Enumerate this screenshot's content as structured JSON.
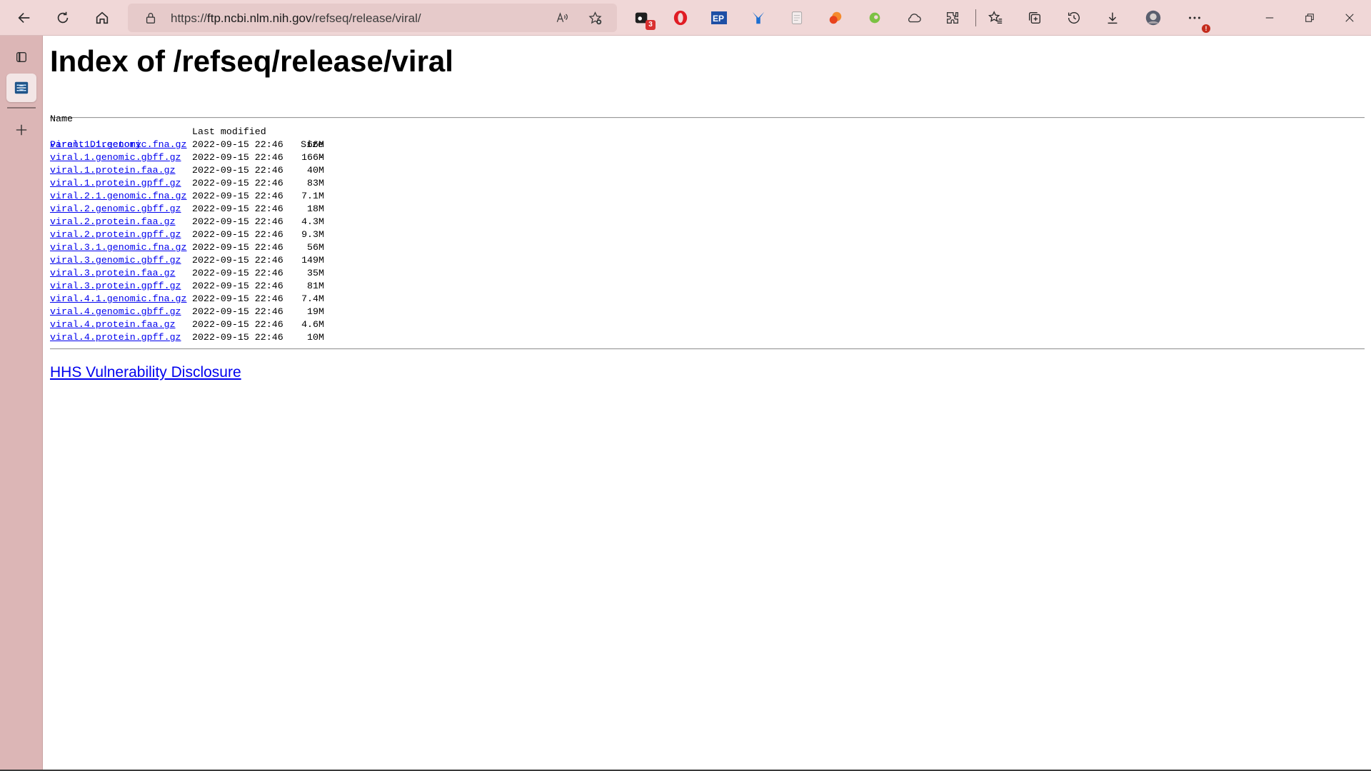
{
  "browser": {
    "url_scheme": "https://",
    "url_host": "ftp.ncbi.nlm.nih.gov",
    "url_path": "/refseq/release/viral/",
    "extension_badge_count": "3",
    "more_badge": "!",
    "icons": {
      "back": "back-arrow-icon",
      "refresh": "refresh-icon",
      "home": "home-icon",
      "lock": "lock-icon",
      "read_aloud": "read-aloud-icon",
      "favorite_add": "favorite-add-icon",
      "favorites": "favorites-icon",
      "collections": "collections-icon",
      "history": "history-icon",
      "downloads": "download-icon",
      "profile": "profile-avatar",
      "more": "more-icon"
    }
  },
  "sidebar": {
    "icons": [
      "tab-actions-icon",
      "active-tab-favicon",
      "new-tab-plus-icon"
    ]
  },
  "page": {
    "title": "Index of /refseq/release/viral",
    "headers": {
      "name": "Name",
      "last_modified": "Last modified",
      "size": "Size"
    },
    "parent": {
      "name": "Parent Directory",
      "size": "-"
    },
    "files": [
      {
        "name": "viral.1.1.genomic.fna.gz",
        "modified": "2022-09-15 22:46",
        "size": "66M"
      },
      {
        "name": "viral.1.genomic.gbff.gz",
        "modified": "2022-09-15 22:46",
        "size": "166M"
      },
      {
        "name": "viral.1.protein.faa.gz",
        "modified": "2022-09-15 22:46",
        "size": "40M"
      },
      {
        "name": "viral.1.protein.gpff.gz",
        "modified": "2022-09-15 22:46",
        "size": "83M"
      },
      {
        "name": "viral.2.1.genomic.fna.gz",
        "modified": "2022-09-15 22:46",
        "size": "7.1M"
      },
      {
        "name": "viral.2.genomic.gbff.gz",
        "modified": "2022-09-15 22:46",
        "size": "18M"
      },
      {
        "name": "viral.2.protein.faa.gz",
        "modified": "2022-09-15 22:46",
        "size": "4.3M"
      },
      {
        "name": "viral.2.protein.gpff.gz",
        "modified": "2022-09-15 22:46",
        "size": "9.3M"
      },
      {
        "name": "viral.3.1.genomic.fna.gz",
        "modified": "2022-09-15 22:46",
        "size": "56M"
      },
      {
        "name": "viral.3.genomic.gbff.gz",
        "modified": "2022-09-15 22:46",
        "size": "149M"
      },
      {
        "name": "viral.3.protein.faa.gz",
        "modified": "2022-09-15 22:46",
        "size": "35M"
      },
      {
        "name": "viral.3.protein.gpff.gz",
        "modified": "2022-09-15 22:46",
        "size": "81M"
      },
      {
        "name": "viral.4.1.genomic.fna.gz",
        "modified": "2022-09-15 22:46",
        "size": "7.4M"
      },
      {
        "name": "viral.4.genomic.gbff.gz",
        "modified": "2022-09-15 22:46",
        "size": "19M"
      },
      {
        "name": "viral.4.protein.faa.gz",
        "modified": "2022-09-15 22:46",
        "size": "4.6M"
      },
      {
        "name": "viral.4.protein.gpff.gz",
        "modified": "2022-09-15 22:46",
        "size": "10M"
      }
    ],
    "footer_link": "HHS Vulnerability Disclosure"
  },
  "colors": {
    "toolbar_bg": "#f0d7d7",
    "sidebar_bg": "#dcb6b6",
    "link": "#0000ee"
  }
}
